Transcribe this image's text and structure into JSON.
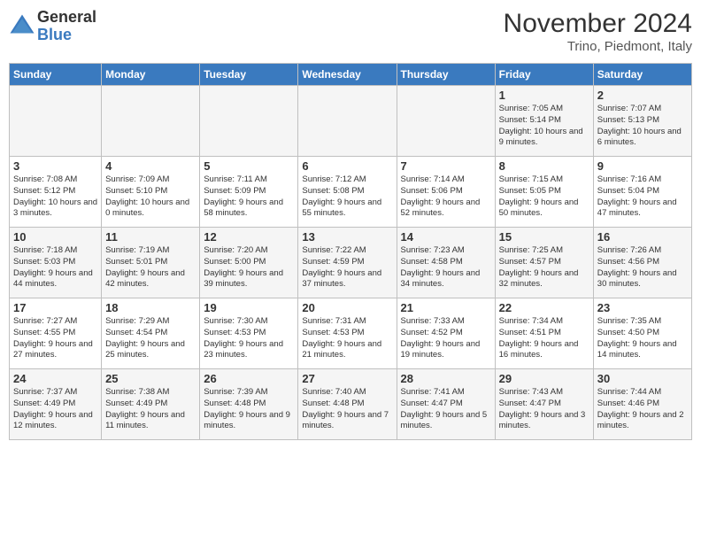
{
  "header": {
    "logo_line1": "General",
    "logo_line2": "Blue",
    "month_title": "November 2024",
    "subtitle": "Trino, Piedmont, Italy"
  },
  "days_of_week": [
    "Sunday",
    "Monday",
    "Tuesday",
    "Wednesday",
    "Thursday",
    "Friday",
    "Saturday"
  ],
  "weeks": [
    [
      {
        "day": "",
        "info": ""
      },
      {
        "day": "",
        "info": ""
      },
      {
        "day": "",
        "info": ""
      },
      {
        "day": "",
        "info": ""
      },
      {
        "day": "",
        "info": ""
      },
      {
        "day": "1",
        "info": "Sunrise: 7:05 AM\nSunset: 5:14 PM\nDaylight: 10 hours and 9 minutes."
      },
      {
        "day": "2",
        "info": "Sunrise: 7:07 AM\nSunset: 5:13 PM\nDaylight: 10 hours and 6 minutes."
      }
    ],
    [
      {
        "day": "3",
        "info": "Sunrise: 7:08 AM\nSunset: 5:12 PM\nDaylight: 10 hours and 3 minutes."
      },
      {
        "day": "4",
        "info": "Sunrise: 7:09 AM\nSunset: 5:10 PM\nDaylight: 10 hours and 0 minutes."
      },
      {
        "day": "5",
        "info": "Sunrise: 7:11 AM\nSunset: 5:09 PM\nDaylight: 9 hours and 58 minutes."
      },
      {
        "day": "6",
        "info": "Sunrise: 7:12 AM\nSunset: 5:08 PM\nDaylight: 9 hours and 55 minutes."
      },
      {
        "day": "7",
        "info": "Sunrise: 7:14 AM\nSunset: 5:06 PM\nDaylight: 9 hours and 52 minutes."
      },
      {
        "day": "8",
        "info": "Sunrise: 7:15 AM\nSunset: 5:05 PM\nDaylight: 9 hours and 50 minutes."
      },
      {
        "day": "9",
        "info": "Sunrise: 7:16 AM\nSunset: 5:04 PM\nDaylight: 9 hours and 47 minutes."
      }
    ],
    [
      {
        "day": "10",
        "info": "Sunrise: 7:18 AM\nSunset: 5:03 PM\nDaylight: 9 hours and 44 minutes."
      },
      {
        "day": "11",
        "info": "Sunrise: 7:19 AM\nSunset: 5:01 PM\nDaylight: 9 hours and 42 minutes."
      },
      {
        "day": "12",
        "info": "Sunrise: 7:20 AM\nSunset: 5:00 PM\nDaylight: 9 hours and 39 minutes."
      },
      {
        "day": "13",
        "info": "Sunrise: 7:22 AM\nSunset: 4:59 PM\nDaylight: 9 hours and 37 minutes."
      },
      {
        "day": "14",
        "info": "Sunrise: 7:23 AM\nSunset: 4:58 PM\nDaylight: 9 hours and 34 minutes."
      },
      {
        "day": "15",
        "info": "Sunrise: 7:25 AM\nSunset: 4:57 PM\nDaylight: 9 hours and 32 minutes."
      },
      {
        "day": "16",
        "info": "Sunrise: 7:26 AM\nSunset: 4:56 PM\nDaylight: 9 hours and 30 minutes."
      }
    ],
    [
      {
        "day": "17",
        "info": "Sunrise: 7:27 AM\nSunset: 4:55 PM\nDaylight: 9 hours and 27 minutes."
      },
      {
        "day": "18",
        "info": "Sunrise: 7:29 AM\nSunset: 4:54 PM\nDaylight: 9 hours and 25 minutes."
      },
      {
        "day": "19",
        "info": "Sunrise: 7:30 AM\nSunset: 4:53 PM\nDaylight: 9 hours and 23 minutes."
      },
      {
        "day": "20",
        "info": "Sunrise: 7:31 AM\nSunset: 4:53 PM\nDaylight: 9 hours and 21 minutes."
      },
      {
        "day": "21",
        "info": "Sunrise: 7:33 AM\nSunset: 4:52 PM\nDaylight: 9 hours and 19 minutes."
      },
      {
        "day": "22",
        "info": "Sunrise: 7:34 AM\nSunset: 4:51 PM\nDaylight: 9 hours and 16 minutes."
      },
      {
        "day": "23",
        "info": "Sunrise: 7:35 AM\nSunset: 4:50 PM\nDaylight: 9 hours and 14 minutes."
      }
    ],
    [
      {
        "day": "24",
        "info": "Sunrise: 7:37 AM\nSunset: 4:49 PM\nDaylight: 9 hours and 12 minutes."
      },
      {
        "day": "25",
        "info": "Sunrise: 7:38 AM\nSunset: 4:49 PM\nDaylight: 9 hours and 11 minutes."
      },
      {
        "day": "26",
        "info": "Sunrise: 7:39 AM\nSunset: 4:48 PM\nDaylight: 9 hours and 9 minutes."
      },
      {
        "day": "27",
        "info": "Sunrise: 7:40 AM\nSunset: 4:48 PM\nDaylight: 9 hours and 7 minutes."
      },
      {
        "day": "28",
        "info": "Sunrise: 7:41 AM\nSunset: 4:47 PM\nDaylight: 9 hours and 5 minutes."
      },
      {
        "day": "29",
        "info": "Sunrise: 7:43 AM\nSunset: 4:47 PM\nDaylight: 9 hours and 3 minutes."
      },
      {
        "day": "30",
        "info": "Sunrise: 7:44 AM\nSunset: 4:46 PM\nDaylight: 9 hours and 2 minutes."
      }
    ]
  ]
}
